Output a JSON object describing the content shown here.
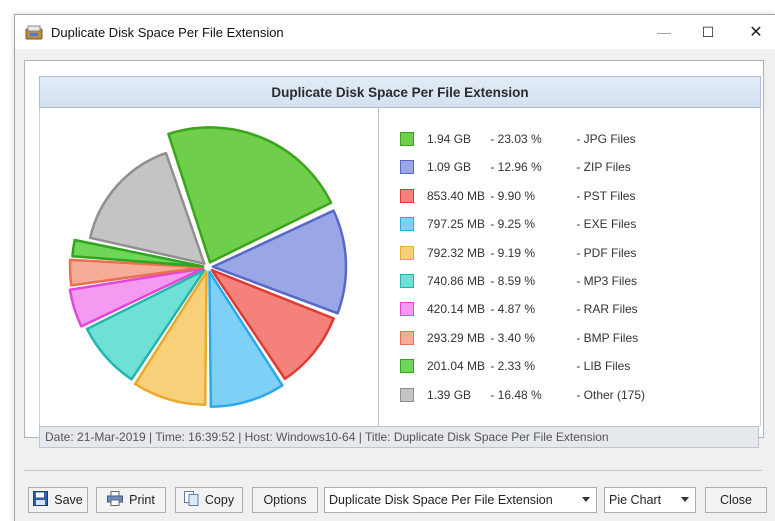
{
  "window": {
    "title": "Duplicate Disk Space Per File Extension",
    "min_glyph": "—",
    "max_glyph": "☐",
    "close_glyph": "✕"
  },
  "chart_header": "Duplicate Disk Space Per File Extension",
  "chart_data": {
    "type": "pie",
    "title": "Duplicate Disk Space Per File Extension",
    "slices": [
      {
        "label": "JPG Files",
        "size": "1.94 GB",
        "percent_text": "23.03 %",
        "value": 23.03,
        "color": "#6fcf4a",
        "border": "#3aa51a"
      },
      {
        "label": "ZIP Files",
        "size": "1.09 GB",
        "percent_text": "12.96 %",
        "value": 12.96,
        "color": "#9aa6e6",
        "border": "#5868c8"
      },
      {
        "label": "PST Files",
        "size": "853.40 MB",
        "percent_text": "9.90 %",
        "value": 9.9,
        "color": "#f4827a",
        "border": "#e03b32"
      },
      {
        "label": "EXE Files",
        "size": "797.25 MB",
        "percent_text": "9.25 %",
        "value": 9.25,
        "color": "#7fd0f6",
        "border": "#2aa9e8"
      },
      {
        "label": "PDF Files",
        "size": "792.32 MB",
        "percent_text": "9.19 %",
        "value": 9.19,
        "color": "#f8d07a",
        "border": "#eaa92a"
      },
      {
        "label": "MP3 Files",
        "size": "740.86 MB",
        "percent_text": "8.59 %",
        "value": 8.59,
        "color": "#6fe0d6",
        "border": "#22b6aa"
      },
      {
        "label": "RAR Files",
        "size": "420.14 MB",
        "percent_text": "4.87 %",
        "value": 4.87,
        "color": "#f49af0",
        "border": "#e245d8"
      },
      {
        "label": "BMP Files",
        "size": "293.29 MB",
        "percent_text": "3.40 %",
        "value": 3.4,
        "color": "#f6ad98",
        "border": "#ea6f4f"
      },
      {
        "label": "LIB Files",
        "size": "201.04 MB",
        "percent_text": "2.33 %",
        "value": 2.33,
        "color": "#6fd65a",
        "border": "#2fa51f"
      },
      {
        "label": "Other (175)",
        "size": "1.39 GB",
        "percent_text": "16.48 %",
        "value": 16.48,
        "color": "#c4c4c4",
        "border": "#8f8f8f"
      }
    ]
  },
  "status": "Date: 21-Mar-2019 | Time: 16:39:52 | Host: Windows10-64 | Title: Duplicate Disk Space Per File Extension",
  "toolbar": {
    "save_label": "Save",
    "print_label": "Print",
    "copy_label": "Copy",
    "options_label": "Options",
    "report_select": "Duplicate Disk Space Per File Extension",
    "chart_type_select": "Pie Chart",
    "close_label": "Close"
  }
}
